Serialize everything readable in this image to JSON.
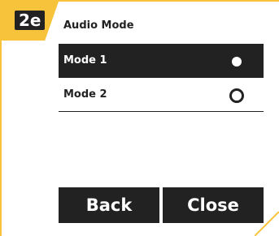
{
  "step": {
    "label": "2e"
  },
  "screen": {
    "title": "Audio Mode",
    "options": [
      {
        "label": "Mode 1",
        "selected": true
      },
      {
        "label": "Mode 2",
        "selected": false
      }
    ],
    "buttons": {
      "back_label": "Back",
      "close_label": "Close"
    }
  },
  "colors": {
    "frame": "#f7c33a",
    "dark": "#222222",
    "light": "#ffffff"
  },
  "icons": {
    "radio": "radio-circle-icon"
  }
}
